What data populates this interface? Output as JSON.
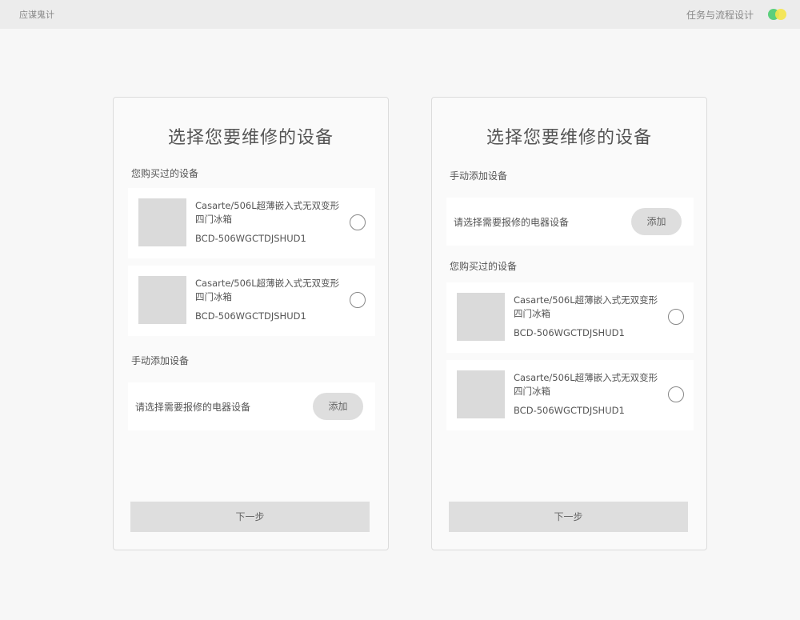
{
  "topbar": {
    "brand": "应谋鬼计",
    "project_title": "任务与流程设计",
    "logo_colors": [
      "#5ccf7c",
      "#f5e64a"
    ]
  },
  "screens": [
    {
      "title": "选择您要维修的设备",
      "purchased_label": "您购买过的设备",
      "manual_label": "手动添加设备",
      "products": [
        {
          "name": "Casarte/506L超薄嵌入式无双变形四门冰箱",
          "model": "BCD-506WGCTDJSHUD1"
        },
        {
          "name": "Casarte/506L超薄嵌入式无双变形四门冰箱",
          "model": "BCD-506WGCTDJSHUD1"
        }
      ],
      "add_hint": "请选择需要报修的电器设备",
      "add_label": "添加",
      "next_label": "下一步"
    },
    {
      "title": "选择您要维修的设备",
      "manual_label": "手动添加设备",
      "purchased_label": "您购买过的设备",
      "add_hint": "请选择需要报修的电器设备",
      "add_label": "添加",
      "products": [
        {
          "name": "Casarte/506L超薄嵌入式无双变形四门冰箱",
          "model": "BCD-506WGCTDJSHUD1"
        },
        {
          "name": "Casarte/506L超薄嵌入式无双变形四门冰箱",
          "model": "BCD-506WGCTDJSHUD1"
        }
      ],
      "next_label": "下一步"
    }
  ]
}
